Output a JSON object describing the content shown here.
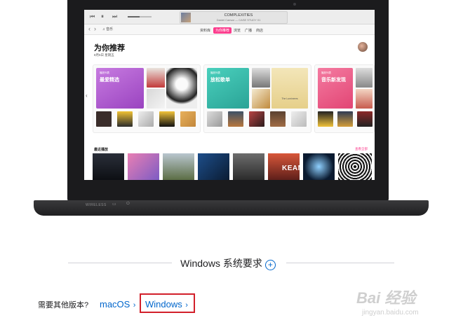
{
  "laptop": {
    "brand_label": "WIRELESS",
    "itunes": {
      "transport": {
        "prev": "⏮",
        "pause": "⏸",
        "next": "⏭"
      },
      "now_playing": {
        "title": "COMPLEXITIES",
        "subtitle": "Daniel Caesar — CASE STUDY 01"
      },
      "nav": {
        "back": "‹",
        "forward": "›",
        "library_label": "♫ 音乐"
      },
      "tabs": [
        {
          "label": "资料库",
          "active": false
        },
        {
          "label": "为你推荐",
          "active": true
        },
        {
          "label": "浏览",
          "active": false
        },
        {
          "label": "广播",
          "active": false
        },
        {
          "label": "商店",
          "active": false
        }
      ],
      "section_title": "为你推荐",
      "section_subtitle": "8月5日 星期五",
      "cards": [
        {
          "title": "最爱精选",
          "tag": "播放列表",
          "color": "#b45bd0"
        },
        {
          "title": "放松歌单",
          "tag": "播放列表",
          "color": "#37c4b3"
        },
        {
          "title": "音乐新发现",
          "tag": "播放列表",
          "color": "#f06290"
        }
      ],
      "recent_title": "最近播放",
      "recent_more": "查看全部",
      "recent_album_text": "KEANE",
      "card_album_text": "The Lumineers"
    }
  },
  "page": {
    "system_requirements": "Windows 系统要求",
    "system_requirements_icon": "plus-circle-icon",
    "other_version_question": "需要其他版本?",
    "links": [
      {
        "label": "macOS",
        "chevron": "›"
      },
      {
        "label": "Windows",
        "chevron": "›",
        "highlighted": true
      }
    ],
    "highlight_color": "#d21f2a",
    "link_color": "#0066cc"
  },
  "watermark": {
    "logo": "Bai 经验",
    "url": "jingyan.baidu.com"
  }
}
